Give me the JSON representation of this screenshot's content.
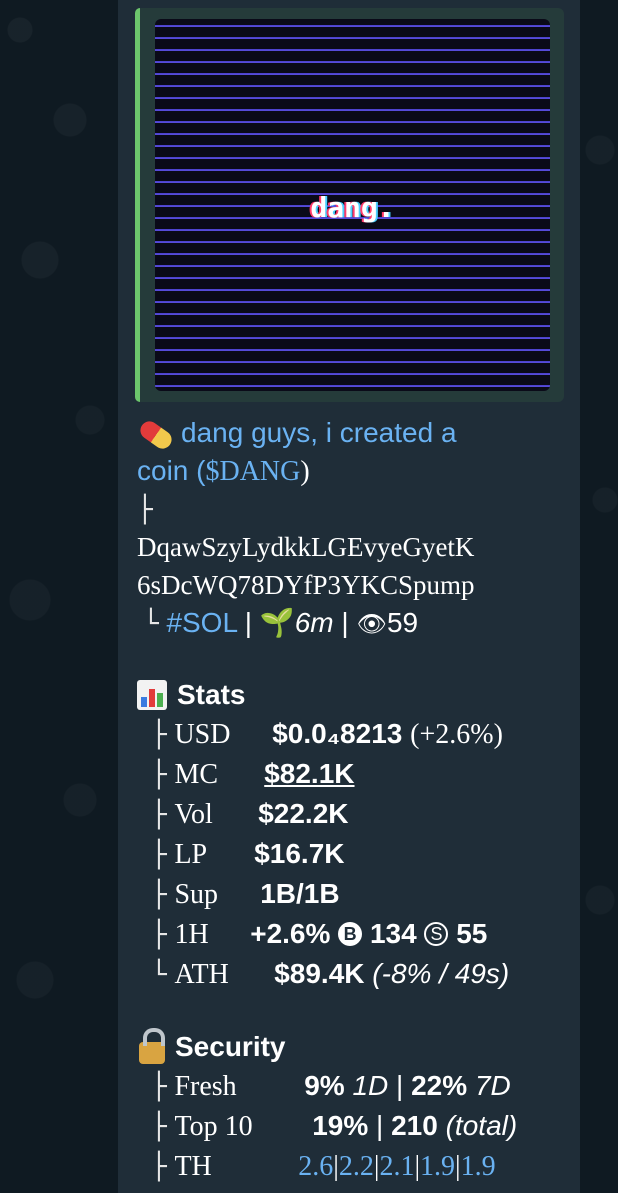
{
  "media": {
    "image_text": "dang."
  },
  "post": {
    "title_icon": "pill-icon",
    "title_line1": "dang guys, i created a",
    "title_line2_prefix": "coin (",
    "ticker": "$DANG",
    "title_line2_suffix": ")",
    "branch_top": "├",
    "address_line1": "DqawSzyLydkkLGEvyeGyetK",
    "address_line2": "6sDcWQ78DYfP3YKCSpump",
    "branch_bottom": "└",
    "chain_tag": "#SOL",
    "sep1": "|",
    "age": "6m",
    "sep2": "|",
    "views": "59"
  },
  "stats": {
    "header": "Stats",
    "icon": "bar-chart-icon",
    "rows": {
      "usd": {
        "branch": "├",
        "label": "USD",
        "value": "$0.0₄8213",
        "change": "(+2.6%)"
      },
      "mc": {
        "branch": "├",
        "label": "MC",
        "value": "$82.1K"
      },
      "vol": {
        "branch": "├",
        "label": "Vol",
        "value": "$22.2K"
      },
      "lp": {
        "branch": "├",
        "label": "LP",
        "value": "$16.7K"
      },
      "sup": {
        "branch": "├",
        "label": "Sup",
        "value": "1B/1B"
      },
      "h1": {
        "branch": "├",
        "label": "1H",
        "change": "+2.6%",
        "buy_icon": "B",
        "buys": "134",
        "sell_icon": "S",
        "sells": "55"
      },
      "ath": {
        "branch": "└",
        "label": "ATH",
        "value": "$89.4K",
        "detail": "(-8% / 49s)"
      }
    }
  },
  "security": {
    "header": "Security",
    "icon": "lock-icon",
    "rows": {
      "fresh": {
        "branch": "├",
        "label": "Fresh",
        "pct1": "9%",
        "period1": "1D",
        "sep": "|",
        "pct2": "22%",
        "period2": "7D"
      },
      "top10": {
        "branch": "├",
        "label": "Top 10",
        "pct": "19%",
        "sep": "|",
        "count": "210",
        "note": "(total)"
      },
      "th": {
        "branch": "├",
        "label": "TH",
        "values": [
          "2.6",
          "2.2",
          "2.1",
          "1.9",
          "1.9"
        ],
        "sep": "|"
      }
    }
  },
  "colors": {
    "bubble": "#1f2d38",
    "link": "#6ab2f2",
    "media_accent": "#6cc56c",
    "background": "#0f1a22"
  }
}
